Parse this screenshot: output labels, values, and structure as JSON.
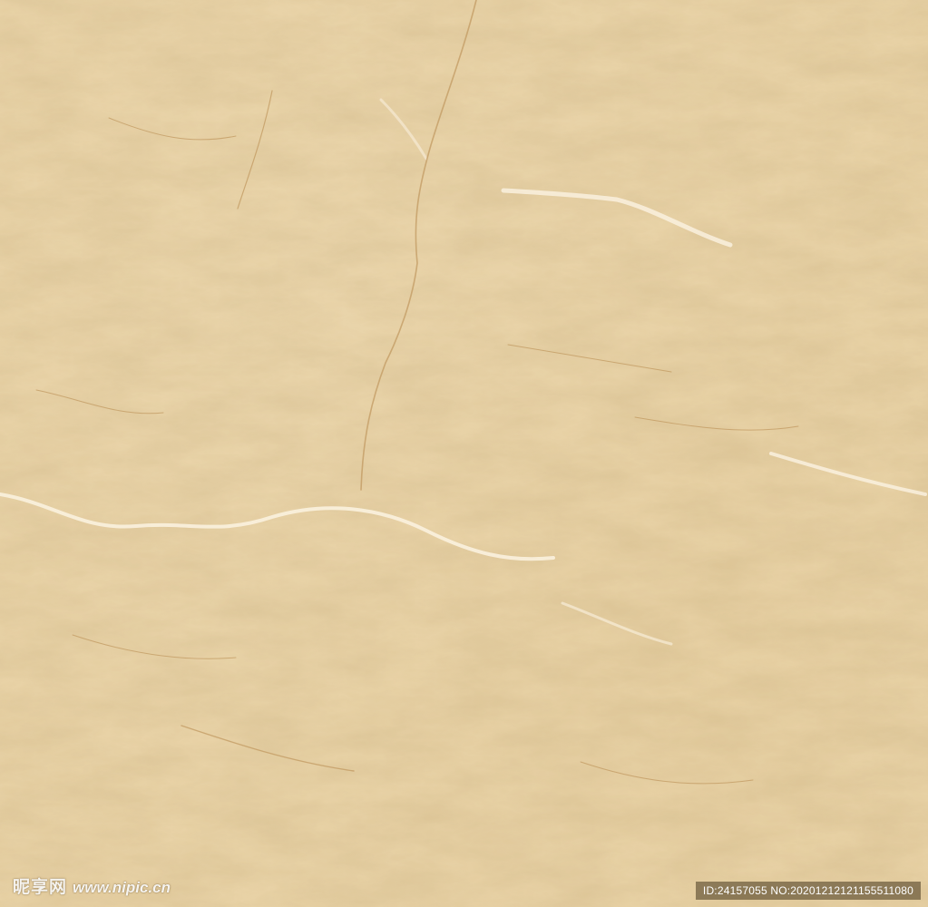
{
  "image": {
    "subject": "beige marble stone texture",
    "colors": {
      "base": "#e8d2a6",
      "light": "#f3e3c2",
      "vein_dark": "#c9a36b",
      "vein_light": "#fbf3e2"
    }
  },
  "watermark": {
    "brand": "昵享网",
    "url": "www.nipic.cn",
    "id_text": "ID:24157055 NO:20201212121155511080"
  }
}
